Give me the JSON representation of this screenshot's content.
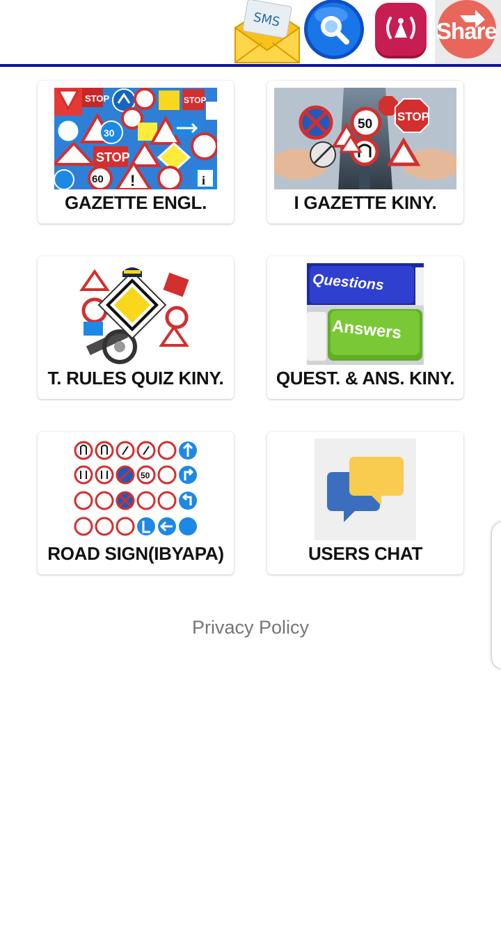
{
  "toolbar": {
    "sms_label": "SMS",
    "share_label": "Share",
    "icons": [
      "sms-envelope-icon",
      "search-icon",
      "broadcast-icon",
      "share-icon"
    ],
    "underline_color": "#0b0fa8"
  },
  "menu": {
    "items": [
      {
        "label": "GAZETTE ENGL.",
        "icon": "road-signs-collage-icon"
      },
      {
        "label": "I GAZETTE KINY.",
        "icon": "signs-in-hands-icon"
      },
      {
        "label": "T. RULES QUIZ KINY.",
        "icon": "priority-road-sign-icon"
      },
      {
        "label": "QUEST. & ANS. KINY.",
        "icon": "questions-answers-keyboard-icon"
      },
      {
        "label": "ROAD SIGN(IBYAPA)",
        "icon": "road-sign-grid-icon"
      },
      {
        "label": "USERS CHAT",
        "icon": "chat-bubbles-icon"
      }
    ]
  },
  "keyboard": {
    "questions": "Questions",
    "answers": "Answers"
  },
  "signs": {
    "speed_50": "50",
    "speed_30": "30",
    "speed_60": "60",
    "stop": "STOP"
  },
  "footer": {
    "privacy_label": "Privacy Policy"
  }
}
